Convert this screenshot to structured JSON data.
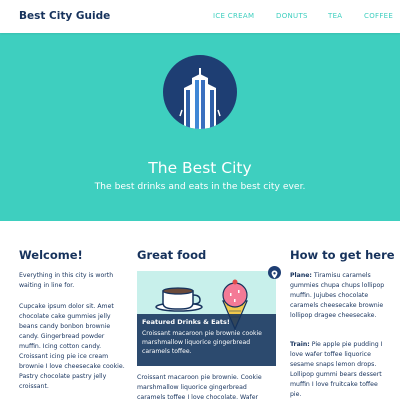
{
  "navbar": {
    "brand": "Best City Guide",
    "links": [
      "ICE CREAM",
      "DONUTS",
      "TEA",
      "COFFEE"
    ]
  },
  "hero": {
    "title": "The Best City",
    "subtitle": "The best drinks and eats in the best city ever."
  },
  "sections": {
    "welcome": {
      "title": "Welcome!",
      "p1": "Everything in this city is worth waiting in line for.",
      "p2": "Cupcake ipsum dolor sit. Amet chocolate cake gummies jelly beans candy bonbon brownie candy. Gingerbread powder muffin. Icing cotton candy. Croissant icing pie ice cream brownie I love cheesecake cookie. Pastry chocolate pastry jelly croissant."
    },
    "food": {
      "title": "Great food",
      "card_title": "Featured Drinks & Eats!",
      "card_text": "Croissant macaroon pie brownie cookie marshmallow liquorice gingerbread caramels toffee.",
      "below_text": "Croissant macaroon pie brownie. Cookie marshmallow liquorice gingerbread caramels toffee I love chocolate. Wafer"
    },
    "directions": {
      "title": "How to get here",
      "plane_label": "Plane:",
      "plane_text": " Tiramisu caramels gummies chupa chups lollipop muffin. Jujubes chocolate caramels cheesecake brownie lollipop dragee cheesecake.",
      "train_label": "Train:",
      "train_text": " Pie apple pie pudding I love wafer toffee liquorice sesame snaps lemon drops. Lollipop gummi bears dessert muffin I love fruitcake toffee pie."
    }
  },
  "colors": {
    "accent": "#3ecfbf",
    "navy": "#16325c",
    "logo_bg": "#1e3e73"
  },
  "icons": [
    "city-building-icon",
    "coffee-cup-icon",
    "ice-cream-icon",
    "map-pin-icon"
  ]
}
